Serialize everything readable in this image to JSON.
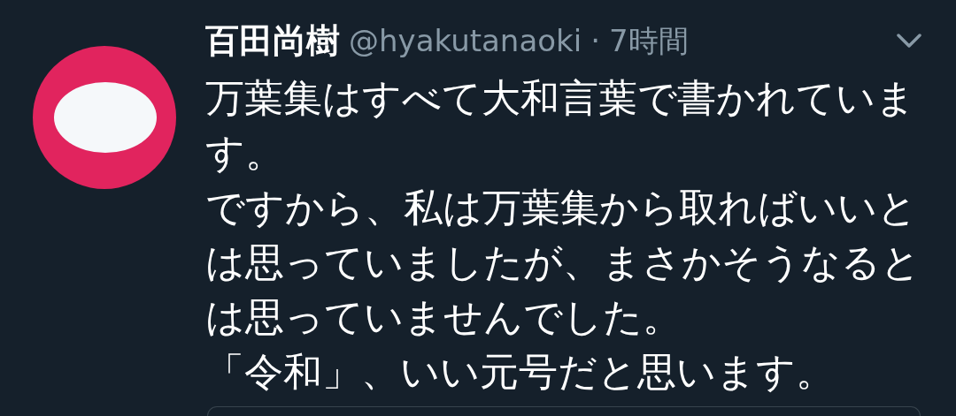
{
  "tweet": {
    "author_name": "百田尚樹",
    "handle": "@hyakutanaoki",
    "separator": "·",
    "time": "7時間",
    "paragraphs": [
      "万葉集はすべて大和言葉で書かれています。",
      "ですから、私は万葉集から取ればいいとは思っていましたが、まさかそうなるとは思っていませんでした。",
      "「令和」、いい元号だと思います。"
    ]
  }
}
